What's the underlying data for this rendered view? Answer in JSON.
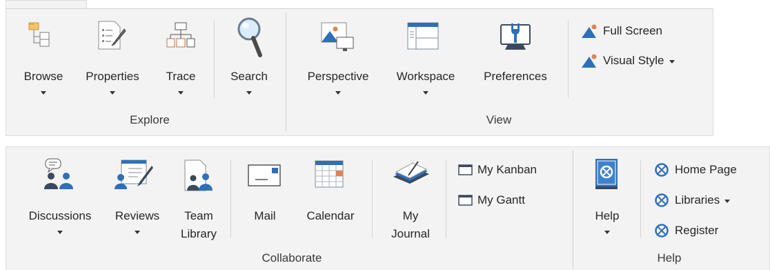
{
  "explore": {
    "group_label": "Explore",
    "browse": "Browse",
    "properties": "Properties",
    "trace": "Trace",
    "search": "Search"
  },
  "view": {
    "group_label": "View",
    "perspective": "Perspective",
    "workspace": "Workspace",
    "preferences": "Preferences",
    "full_screen": "Full Screen",
    "visual_style": "Visual Style"
  },
  "collaborate": {
    "group_label": "Collaborate",
    "discussions": "Discussions",
    "reviews": "Reviews",
    "team_library_line1": "Team",
    "team_library_line2": "Library",
    "mail": "Mail",
    "calendar": "Calendar",
    "my_journal_line1": "My",
    "my_journal_line2": "Journal",
    "my_kanban": "My Kanban",
    "my_gantt": "My Gantt"
  },
  "help": {
    "group_label": "Help",
    "help": "Help",
    "home_page": "Home Page",
    "libraries": "Libraries",
    "register": "Register"
  },
  "colors": {
    "ribbon_bg": "#f3f3f3",
    "accent_blue": "#2f6fba",
    "icon_dark": "#3b4a5c",
    "orange": "#e0834f"
  }
}
